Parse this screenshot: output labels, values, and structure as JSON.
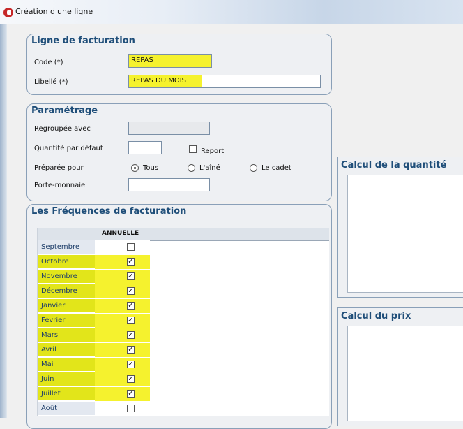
{
  "window": {
    "title": "Création d'une ligne"
  },
  "ligne_facturation": {
    "title": "Ligne de facturation",
    "code_label": "Code (*)",
    "code_value": "REPAS",
    "libelle_label": "Libellé (*)",
    "libelle_value": "REPAS DU MOIS"
  },
  "parametrage": {
    "title": "Paramétrage",
    "regroupee_label": "Regroupée avec",
    "regroupee_value": "",
    "quantite_label": "Quantité par défaut",
    "quantite_value": "",
    "report_label": "Report",
    "report_checked": false,
    "preparee_label": "Préparée pour",
    "options": [
      {
        "label": "Tous",
        "selected": true
      },
      {
        "label": "L'aîné",
        "selected": false
      },
      {
        "label": "Le cadet",
        "selected": false
      }
    ],
    "porte_monnaie_label": "Porte-monnaie",
    "porte_monnaie_value": ""
  },
  "frequences": {
    "title": "Les Fréquences de facturation",
    "column": "ANNUELLE",
    "months": [
      {
        "name": "Septembre",
        "checked": false
      },
      {
        "name": "Octobre",
        "checked": true
      },
      {
        "name": "Novembre",
        "checked": true
      },
      {
        "name": "Décembre",
        "checked": true
      },
      {
        "name": "Janvier",
        "checked": true
      },
      {
        "name": "Février",
        "checked": true
      },
      {
        "name": "Mars",
        "checked": true
      },
      {
        "name": "Avril",
        "checked": true
      },
      {
        "name": "Mai",
        "checked": true
      },
      {
        "name": "Juin",
        "checked": true
      },
      {
        "name": "Juillet",
        "checked": true
      },
      {
        "name": "Août",
        "checked": false
      }
    ]
  },
  "calcul_quantite": {
    "title": "Calcul de la quantité"
  },
  "calcul_prix": {
    "title": "Calcul du prix"
  },
  "colors": {
    "highlight": "#f5f22e",
    "group_title": "#1f4e79",
    "border": "#8aa0b8"
  }
}
